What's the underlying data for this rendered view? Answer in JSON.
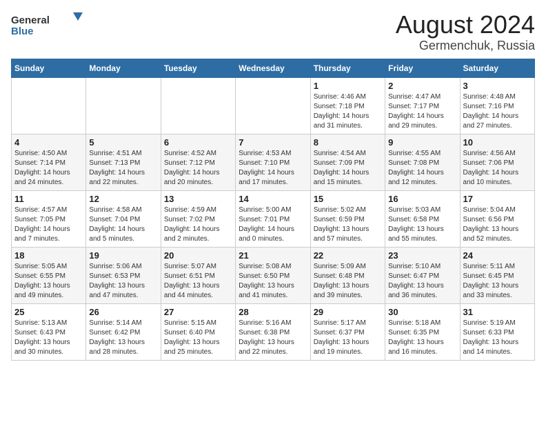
{
  "header": {
    "logo_general": "General",
    "logo_blue": "Blue",
    "title": "August 2024",
    "subtitle": "Germenchuk, Russia"
  },
  "weekdays": [
    "Sunday",
    "Monday",
    "Tuesday",
    "Wednesday",
    "Thursday",
    "Friday",
    "Saturday"
  ],
  "weeks": [
    [
      {
        "day": "",
        "info": ""
      },
      {
        "day": "",
        "info": ""
      },
      {
        "day": "",
        "info": ""
      },
      {
        "day": "",
        "info": ""
      },
      {
        "day": "1",
        "info": "Sunrise: 4:46 AM\nSunset: 7:18 PM\nDaylight: 14 hours\nand 31 minutes."
      },
      {
        "day": "2",
        "info": "Sunrise: 4:47 AM\nSunset: 7:17 PM\nDaylight: 14 hours\nand 29 minutes."
      },
      {
        "day": "3",
        "info": "Sunrise: 4:48 AM\nSunset: 7:16 PM\nDaylight: 14 hours\nand 27 minutes."
      }
    ],
    [
      {
        "day": "4",
        "info": "Sunrise: 4:50 AM\nSunset: 7:14 PM\nDaylight: 14 hours\nand 24 minutes."
      },
      {
        "day": "5",
        "info": "Sunrise: 4:51 AM\nSunset: 7:13 PM\nDaylight: 14 hours\nand 22 minutes."
      },
      {
        "day": "6",
        "info": "Sunrise: 4:52 AM\nSunset: 7:12 PM\nDaylight: 14 hours\nand 20 minutes."
      },
      {
        "day": "7",
        "info": "Sunrise: 4:53 AM\nSunset: 7:10 PM\nDaylight: 14 hours\nand 17 minutes."
      },
      {
        "day": "8",
        "info": "Sunrise: 4:54 AM\nSunset: 7:09 PM\nDaylight: 14 hours\nand 15 minutes."
      },
      {
        "day": "9",
        "info": "Sunrise: 4:55 AM\nSunset: 7:08 PM\nDaylight: 14 hours\nand 12 minutes."
      },
      {
        "day": "10",
        "info": "Sunrise: 4:56 AM\nSunset: 7:06 PM\nDaylight: 14 hours\nand 10 minutes."
      }
    ],
    [
      {
        "day": "11",
        "info": "Sunrise: 4:57 AM\nSunset: 7:05 PM\nDaylight: 14 hours\nand 7 minutes."
      },
      {
        "day": "12",
        "info": "Sunrise: 4:58 AM\nSunset: 7:04 PM\nDaylight: 14 hours\nand 5 minutes."
      },
      {
        "day": "13",
        "info": "Sunrise: 4:59 AM\nSunset: 7:02 PM\nDaylight: 14 hours\nand 2 minutes."
      },
      {
        "day": "14",
        "info": "Sunrise: 5:00 AM\nSunset: 7:01 PM\nDaylight: 14 hours\nand 0 minutes."
      },
      {
        "day": "15",
        "info": "Sunrise: 5:02 AM\nSunset: 6:59 PM\nDaylight: 13 hours\nand 57 minutes."
      },
      {
        "day": "16",
        "info": "Sunrise: 5:03 AM\nSunset: 6:58 PM\nDaylight: 13 hours\nand 55 minutes."
      },
      {
        "day": "17",
        "info": "Sunrise: 5:04 AM\nSunset: 6:56 PM\nDaylight: 13 hours\nand 52 minutes."
      }
    ],
    [
      {
        "day": "18",
        "info": "Sunrise: 5:05 AM\nSunset: 6:55 PM\nDaylight: 13 hours\nand 49 minutes."
      },
      {
        "day": "19",
        "info": "Sunrise: 5:06 AM\nSunset: 6:53 PM\nDaylight: 13 hours\nand 47 minutes."
      },
      {
        "day": "20",
        "info": "Sunrise: 5:07 AM\nSunset: 6:51 PM\nDaylight: 13 hours\nand 44 minutes."
      },
      {
        "day": "21",
        "info": "Sunrise: 5:08 AM\nSunset: 6:50 PM\nDaylight: 13 hours\nand 41 minutes."
      },
      {
        "day": "22",
        "info": "Sunrise: 5:09 AM\nSunset: 6:48 PM\nDaylight: 13 hours\nand 39 minutes."
      },
      {
        "day": "23",
        "info": "Sunrise: 5:10 AM\nSunset: 6:47 PM\nDaylight: 13 hours\nand 36 minutes."
      },
      {
        "day": "24",
        "info": "Sunrise: 5:11 AM\nSunset: 6:45 PM\nDaylight: 13 hours\nand 33 minutes."
      }
    ],
    [
      {
        "day": "25",
        "info": "Sunrise: 5:13 AM\nSunset: 6:43 PM\nDaylight: 13 hours\nand 30 minutes."
      },
      {
        "day": "26",
        "info": "Sunrise: 5:14 AM\nSunset: 6:42 PM\nDaylight: 13 hours\nand 28 minutes."
      },
      {
        "day": "27",
        "info": "Sunrise: 5:15 AM\nSunset: 6:40 PM\nDaylight: 13 hours\nand 25 minutes."
      },
      {
        "day": "28",
        "info": "Sunrise: 5:16 AM\nSunset: 6:38 PM\nDaylight: 13 hours\nand 22 minutes."
      },
      {
        "day": "29",
        "info": "Sunrise: 5:17 AM\nSunset: 6:37 PM\nDaylight: 13 hours\nand 19 minutes."
      },
      {
        "day": "30",
        "info": "Sunrise: 5:18 AM\nSunset: 6:35 PM\nDaylight: 13 hours\nand 16 minutes."
      },
      {
        "day": "31",
        "info": "Sunrise: 5:19 AM\nSunset: 6:33 PM\nDaylight: 13 hours\nand 14 minutes."
      }
    ]
  ]
}
